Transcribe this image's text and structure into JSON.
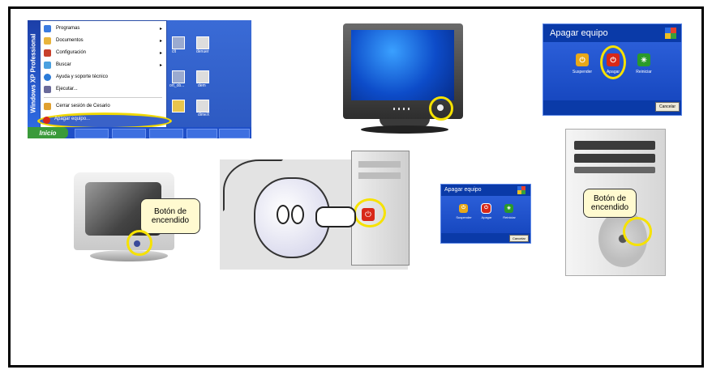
{
  "start_menu": {
    "os_label": "Windows XP Professional",
    "items": [
      {
        "label": "Programas",
        "color": "#3a7be0"
      },
      {
        "label": "Documentos",
        "color": "#e8b43c"
      },
      {
        "label": "Configuración",
        "color": "#c8402c"
      },
      {
        "label": "Buscar",
        "color": "#4aa0e0"
      },
      {
        "label": "Ayuda y soporte técnico",
        "color": "#2a7ad8"
      },
      {
        "label": "Ejecutar...",
        "color": "#6a6a9a"
      },
      {
        "label": "Cerrar sesión de Cesario",
        "color": "#e0a030"
      }
    ],
    "shutdown_label": "Apagar equipo...",
    "start_button": "Inicio",
    "desktop_labels": [
      "clt",
      "denuer",
      "ort_ob...",
      "dem",
      "dimeX"
    ]
  },
  "dialog_large": {
    "title": "Apagar equipo",
    "buttons": [
      {
        "label": "Suspender",
        "color": "#e8a818"
      },
      {
        "label": "Apagar",
        "color": "#d82818"
      },
      {
        "label": "Reiniciar",
        "color": "#2a9a2a"
      }
    ],
    "cancel_label": "Cancelar"
  },
  "dialog_small": {
    "title": "Apagar equipo",
    "buttons": [
      {
        "label": "Suspender",
        "color": "#e8a818"
      },
      {
        "label": "Apagar",
        "color": "#d82818"
      },
      {
        "label": "Reiniciar",
        "color": "#2a9a2a"
      }
    ],
    "cancel_label": "Cancelar"
  },
  "callouts": {
    "monitor": "Botón de encendido",
    "tower": "Botón de encendido"
  },
  "colors": {
    "highlight_ring": "#f6e200",
    "xp_blue": "#2b5ed8",
    "power_red": "#d82818"
  }
}
